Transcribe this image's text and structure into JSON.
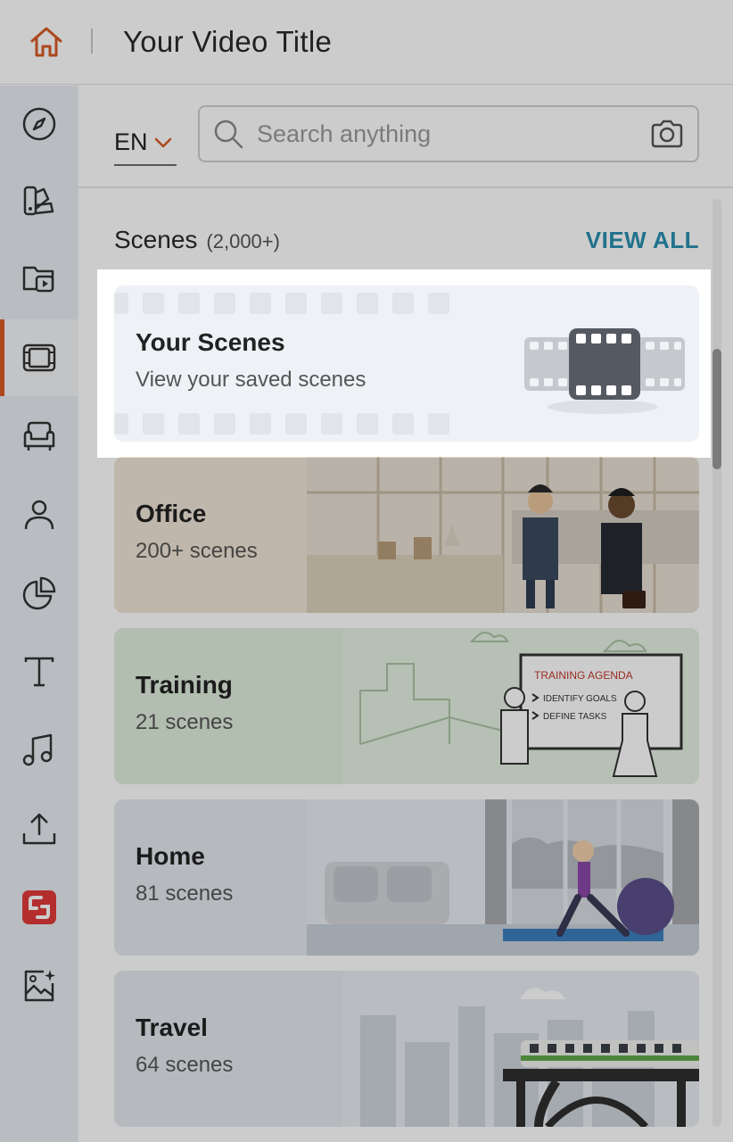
{
  "header": {
    "title": "Your Video Title",
    "home_icon": "home-icon"
  },
  "sidebar": {
    "items": [
      {
        "icon": "compass-icon",
        "active": false
      },
      {
        "icon": "palette-icon",
        "active": false
      },
      {
        "icon": "video-folder-icon",
        "active": false
      },
      {
        "icon": "film-icon",
        "active": true
      },
      {
        "icon": "armchair-icon",
        "active": false
      },
      {
        "icon": "person-icon",
        "active": false
      },
      {
        "icon": "pie-chart-icon",
        "active": false
      },
      {
        "icon": "text-icon",
        "active": false
      },
      {
        "icon": "music-note-icon",
        "active": false
      },
      {
        "icon": "upload-icon",
        "active": false
      },
      {
        "icon": "brand-logo-icon",
        "active": false
      },
      {
        "icon": "ai-image-icon",
        "active": false
      }
    ]
  },
  "toolbar": {
    "language": "EN",
    "search_placeholder": "Search anything"
  },
  "scenes": {
    "title": "Scenes",
    "count": "(2,000+)",
    "view_all": "VIEW ALL",
    "cards": [
      {
        "title": "Your Scenes",
        "subtitle": "View your saved scenes",
        "bg": "#eef1f5"
      },
      {
        "title": "Office",
        "subtitle": "200+ scenes",
        "bg": "#efe5d6"
      },
      {
        "title": "Training",
        "subtitle": "21 scenes",
        "bg": "#dfeedc"
      },
      {
        "title": "Home",
        "subtitle": "81 scenes",
        "bg": "#e4e9ef"
      },
      {
        "title": "Travel",
        "subtitle": "64 scenes",
        "bg": "#e4e9ef"
      }
    ]
  },
  "colors": {
    "accent": "#d65a23",
    "link": "#2a8fb0",
    "overlay": "rgba(0,0,0,0.2)"
  }
}
